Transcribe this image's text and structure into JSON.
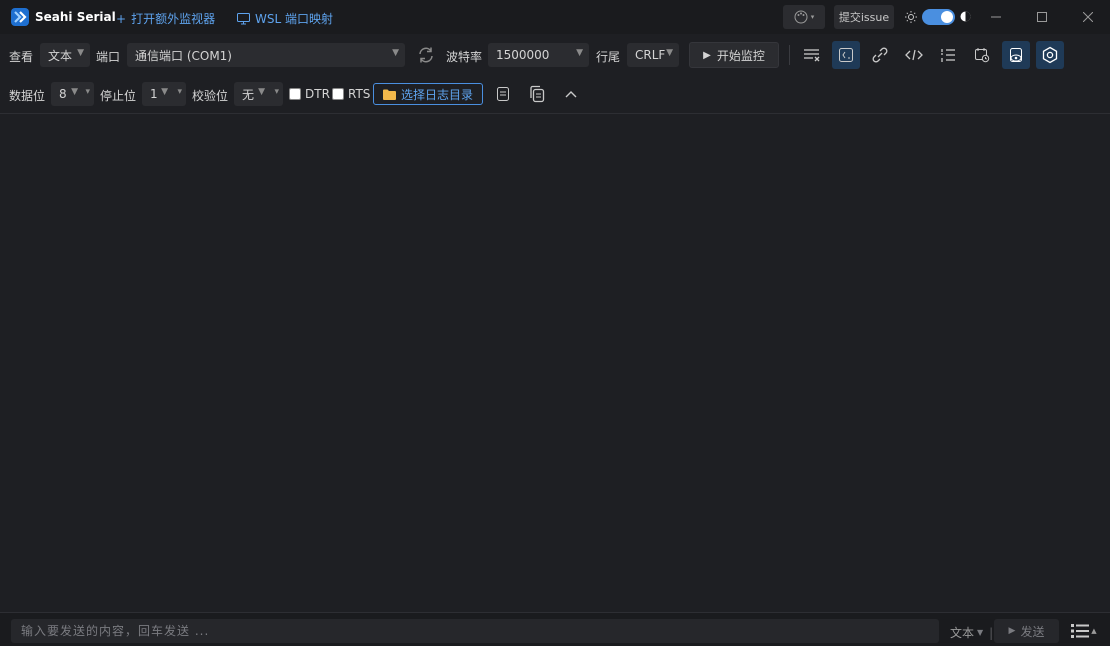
{
  "titlebar": {
    "app_name": "Seahi Serial",
    "open_monitor": "打开额外监视器",
    "wsl_mapping": "WSL 端口映射",
    "issue": "提交issue",
    "theme_dark": true
  },
  "toolbar": {
    "view_label": "查看",
    "view_value": "文本",
    "port_label": "端口",
    "port_value": "通信端口 (COM1)",
    "baud_label": "波特率",
    "baud_value": "1500000",
    "eol_label": "行尾",
    "eol_value": "CRLF",
    "start_monitor": "开始监控"
  },
  "toolbar2": {
    "databits_label": "数据位",
    "databits_value": "8",
    "stopbits_label": "停止位",
    "stopbits_value": "1",
    "parity_label": "校验位",
    "parity_value": "无",
    "dtr_label": "DTR",
    "rts_label": "RTS",
    "log_dir": "选择日志目录"
  },
  "bottom": {
    "input_placeholder": "输入要发送的内容，回车发送 ...",
    "format_value": "文本",
    "send": "发送"
  },
  "colors": {
    "accent": "#4a8fe0",
    "link": "#5ea3ee",
    "background": "#1e1f23"
  }
}
